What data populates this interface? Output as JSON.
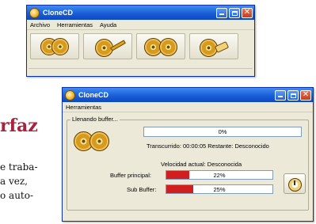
{
  "background_text": {
    "headline": "rfaz",
    "lines": [
      "e traba-",
      "a vez,",
      "o auto-"
    ]
  },
  "window1": {
    "title": "CloneCD",
    "menu": [
      "Archivo",
      "Herramientas",
      "Ayuda"
    ],
    "toolbar_buttons": [
      {
        "name": "read-to-image",
        "icon": "binoculars-cd-icon"
      },
      {
        "name": "write-from-image",
        "icon": "cd-pencil-icon"
      },
      {
        "name": "copy-cd",
        "icon": "two-cd-icon"
      },
      {
        "name": "erase-cd",
        "icon": "cd-eraser-icon"
      }
    ]
  },
  "window2": {
    "title": "CloneCD",
    "menu": [
      "Herramientas"
    ],
    "group_label": "Llenando buffer...",
    "progress_value": "0%",
    "elapsed_text": "Transcurrido: 00:00:05  Restante: Desconocido",
    "speed_text": "Velocidad actual: Desconocida",
    "buffers": [
      {
        "label": "Buffer principal:",
        "value_text": "22%",
        "fill_fraction": 0.22
      },
      {
        "label": "Sub Buffer:",
        "value_text": "25%",
        "fill_fraction": 0.25
      }
    ],
    "cancel_icon": "stopwatch-icon"
  },
  "colors": {
    "title_blue": "#1a5fd6",
    "window_bg": "#ece9d8",
    "headline": "#a8233e",
    "buffer_fill": "#d11f1f"
  }
}
